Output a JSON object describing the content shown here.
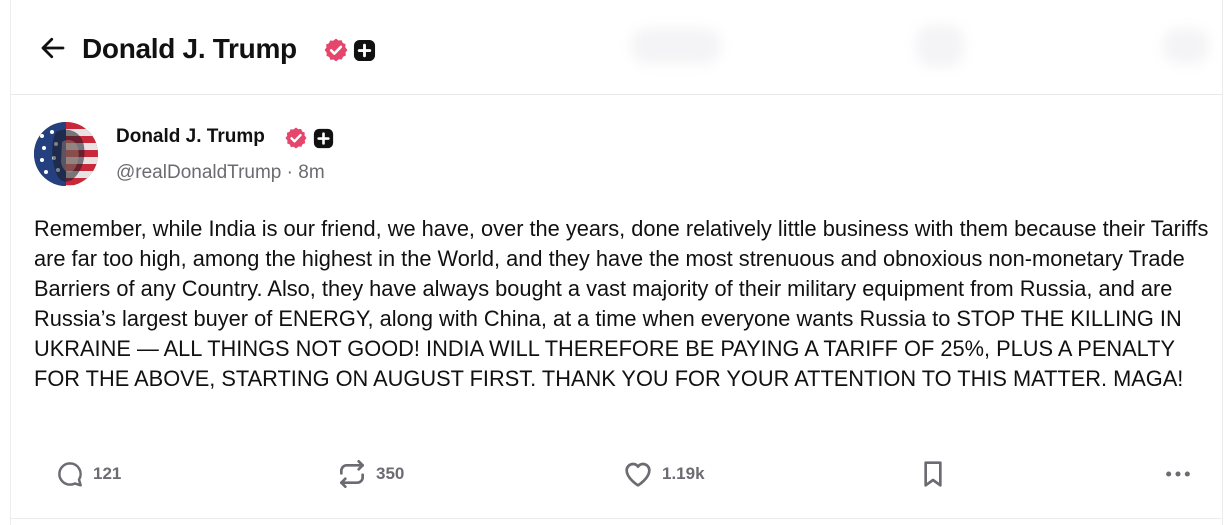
{
  "header": {
    "title": "Donald J. Trump",
    "back_icon": "arrow-left-icon",
    "verified_icon": "verified-badge-icon",
    "plus_icon": "plus-badge-icon"
  },
  "post": {
    "author_name": "Donald J. Trump",
    "handle": "@realDonaldTrump",
    "separator": " · ",
    "time": "8m",
    "body": "Remember, while India is our friend, we have, over the years, done relatively little business with them because their Tariffs are far too high, among the highest in the World, and they have the most strenuous and obnoxious non-monetary Trade Barriers of any Country. Also, they have always bought a vast majority of their military equipment from Russia, and are Russia’s largest buyer of ENERGY, along with China, at a time when everyone wants Russia to STOP THE KILLING IN UKRAINE — ALL THINGS NOT GOOD! INDIA WILL THEREFORE BE PAYING A TARIFF OF 25%, PLUS A PENALTY FOR THE ABOVE, STARTING ON AUGUST FIRST. THANK YOU FOR YOUR ATTENTION TO THIS MATTER. MAGA!"
  },
  "actions": {
    "replies": "121",
    "reposts": "350",
    "likes": "1.19k"
  },
  "colors": {
    "verified": "#e4476b",
    "muted": "#6b6b72",
    "text": "#111111"
  }
}
